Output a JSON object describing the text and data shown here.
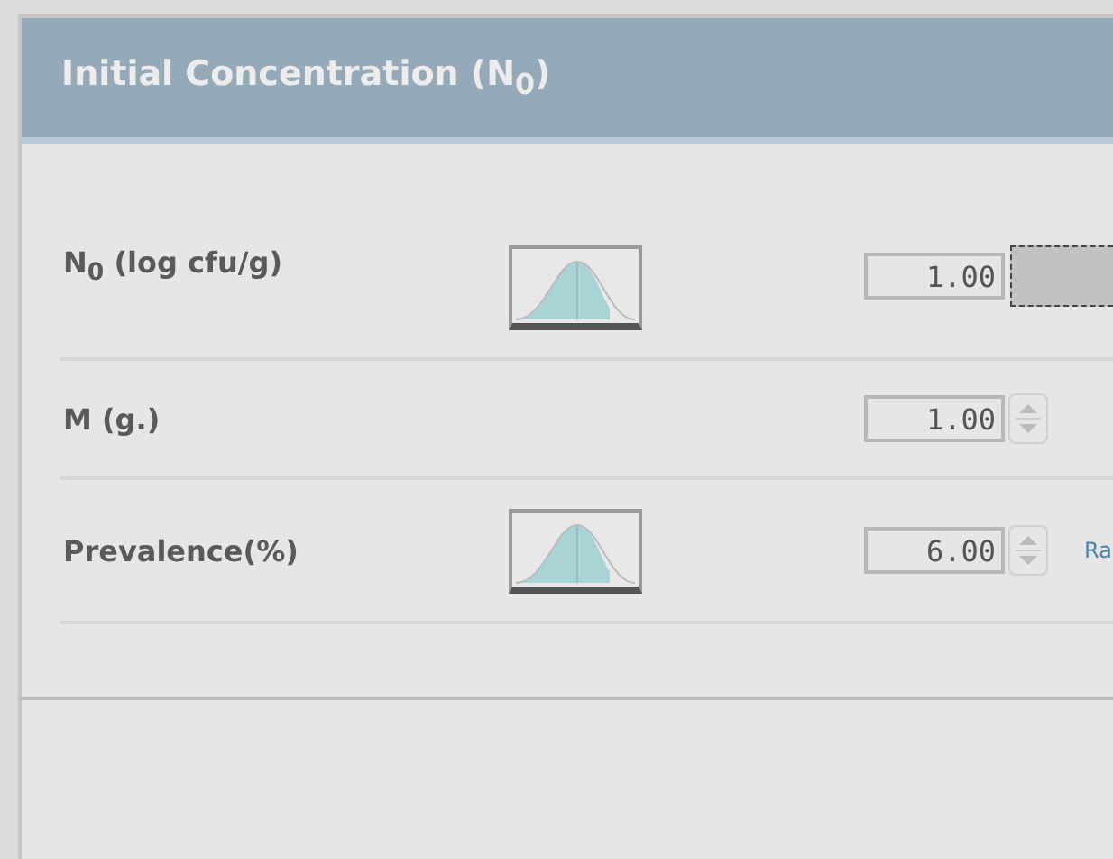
{
  "panel": {
    "title": "Initial Concentration (N$_{0}$)"
  },
  "rows": [
    {
      "label": "N$_{0}$ (log cfu/g)",
      "distribution": true,
      "value": "1.00",
      "spinner": false,
      "drop_target": true
    },
    {
      "label": "M (g.)",
      "distribution": false,
      "value": "1.00",
      "spinner": true,
      "drop_target": false
    },
    {
      "label": "Prevalence(%)",
      "distribution": true,
      "value": "6.00",
      "spinner": true,
      "drop_target": false,
      "link": "Ra"
    }
  ]
}
